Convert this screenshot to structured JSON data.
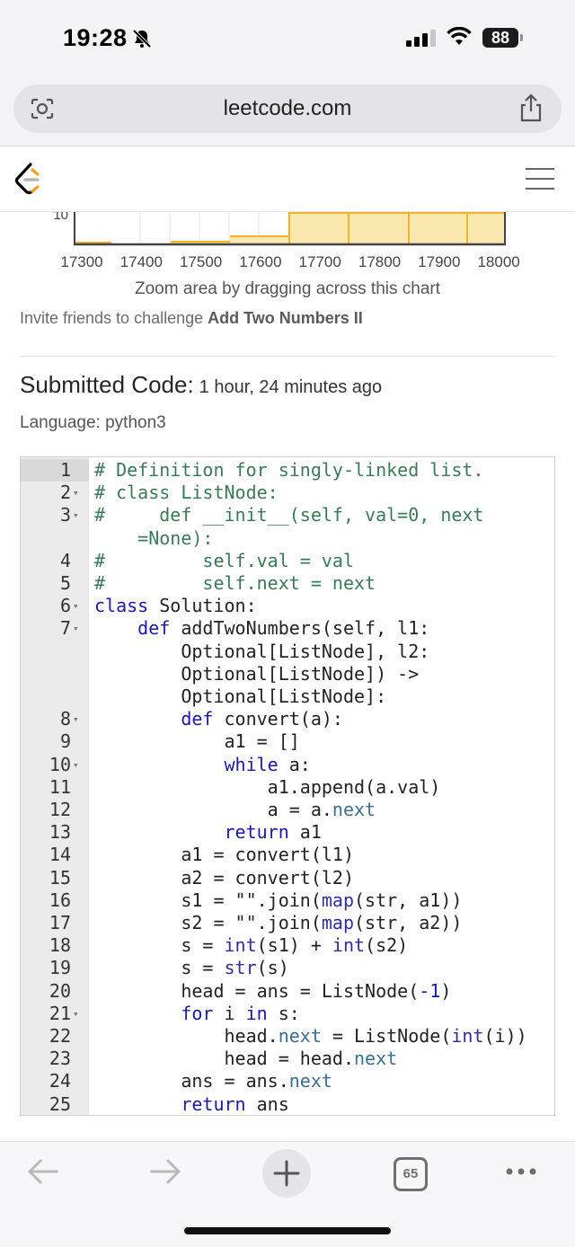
{
  "status_bar": {
    "time": "19:28",
    "battery": "88"
  },
  "browser": {
    "url": "leetcode.com"
  },
  "chart_data": {
    "type": "bar",
    "y_visible_tick": "10",
    "x_ticks": [
      "17300",
      "17400",
      "17500",
      "17600",
      "17700",
      "17800",
      "17900",
      "18000"
    ],
    "fill_color": "#fbe8b0",
    "border_color": "#f0b429"
  },
  "page": {
    "zoom_hint": "Zoom area by dragging across this chart",
    "invite_prefix": "Invite friends to challenge ",
    "problem_name": "Add Two Numbers II",
    "submitted_label": "Submitted Code:",
    "submitted_time": "1 hour, 24 minutes ago",
    "language_label": "Language: python3"
  },
  "code": {
    "lines": [
      {
        "n": "1",
        "fold": false,
        "t": "# Definition for singly-linked list.",
        "cls": "c-comment"
      },
      {
        "n": "2",
        "fold": true,
        "t": "# class ListNode:",
        "cls": "c-comment"
      },
      {
        "n": "3",
        "fold": true,
        "t": "#     def __init__(self, val=0, next",
        "cls": "c-comment"
      },
      {
        "n": "",
        "fold": false,
        "t": "    =None):",
        "cls": "c-comment"
      },
      {
        "n": "4",
        "fold": false,
        "t": "#         self.val = val",
        "cls": "c-comment"
      },
      {
        "n": "5",
        "fold": false,
        "t": "#         self.next = next",
        "cls": "c-comment"
      },
      {
        "n": "6",
        "fold": true,
        "t": "class Solution:",
        "cls": ""
      },
      {
        "n": "7",
        "fold": true,
        "t": "    def addTwoNumbers(self, l1:",
        "cls": ""
      },
      {
        "n": "",
        "fold": false,
        "t": "        Optional[ListNode], l2:",
        "cls": ""
      },
      {
        "n": "",
        "fold": false,
        "t": "        Optional[ListNode]) ->",
        "cls": ""
      },
      {
        "n": "",
        "fold": false,
        "t": "        Optional[ListNode]:",
        "cls": ""
      },
      {
        "n": "8",
        "fold": true,
        "t": "        def convert(a):",
        "cls": ""
      },
      {
        "n": "9",
        "fold": false,
        "t": "            a1 = []",
        "cls": ""
      },
      {
        "n": "10",
        "fold": true,
        "t": "            while a:",
        "cls": ""
      },
      {
        "n": "11",
        "fold": false,
        "t": "                a1.append(a.val)",
        "cls": ""
      },
      {
        "n": "12",
        "fold": false,
        "t": "                a = a.next",
        "cls": ""
      },
      {
        "n": "13",
        "fold": false,
        "t": "            return a1",
        "cls": ""
      },
      {
        "n": "14",
        "fold": false,
        "t": "        a1 = convert(l1)",
        "cls": ""
      },
      {
        "n": "15",
        "fold": false,
        "t": "        a2 = convert(l2)",
        "cls": ""
      },
      {
        "n": "16",
        "fold": false,
        "t": "        s1 = \"\".join(map(str, a1))",
        "cls": ""
      },
      {
        "n": "17",
        "fold": false,
        "t": "        s2 = \"\".join(map(str, a2))",
        "cls": ""
      },
      {
        "n": "18",
        "fold": false,
        "t": "        s = int(s1) + int(s2)",
        "cls": ""
      },
      {
        "n": "19",
        "fold": false,
        "t": "        s = str(s)",
        "cls": ""
      },
      {
        "n": "20",
        "fold": false,
        "t": "        head = ans = ListNode(-1)",
        "cls": ""
      },
      {
        "n": "21",
        "fold": true,
        "t": "        for i in s:",
        "cls": ""
      },
      {
        "n": "22",
        "fold": false,
        "t": "            head.next = ListNode(int(i))",
        "cls": ""
      },
      {
        "n": "23",
        "fold": false,
        "t": "            head = head.next",
        "cls": ""
      },
      {
        "n": "24",
        "fold": false,
        "t": "        ans = ans.next",
        "cls": ""
      },
      {
        "n": "25",
        "fold": false,
        "t": "        return ans",
        "cls": ""
      }
    ]
  },
  "bottom_bar": {
    "tab_count": "65"
  },
  "icons": [
    "bell-slash-icon",
    "signal-icon",
    "wifi-icon",
    "camera-search-icon",
    "share-icon",
    "leetcode-logo",
    "hamburger-menu-icon",
    "back-arrow-icon",
    "forward-arrow-icon",
    "plus-icon",
    "tabs-icon",
    "more-icon"
  ]
}
